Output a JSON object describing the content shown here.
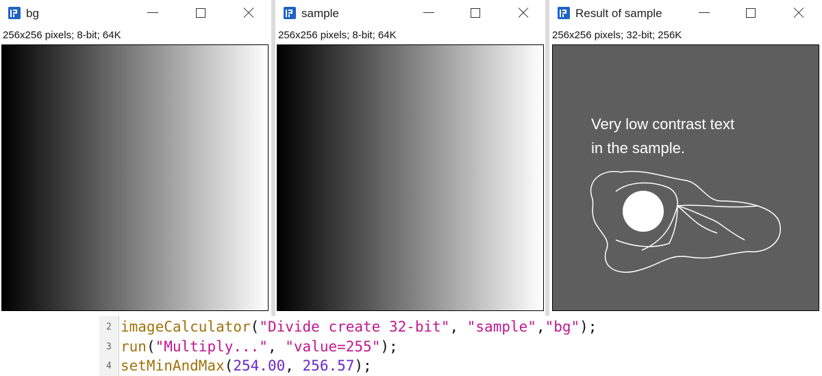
{
  "windows": [
    {
      "title": "bg",
      "info": "256x256 pixels; 8-bit; 64K"
    },
    {
      "title": "sample",
      "info": "256x256 pixels; 8-bit; 64K"
    },
    {
      "title": "Result of sample",
      "info": "256x256 pixels; 32-bit; 256K"
    }
  ],
  "result_image": {
    "text_line1": "Very low contrast text",
    "text_line2": "in the sample.",
    "background_color": "#5e5e5e",
    "drawing_color": "#ffffff"
  },
  "colors": {
    "gradient_start": "#000000",
    "gradient_end": "#ffffff",
    "app_icon": "#1e63c8"
  },
  "code": {
    "lines": [
      {
        "number": "2",
        "tokens": [
          {
            "t": "imageCalculator",
            "k": "fn"
          },
          {
            "t": "(",
            "k": "pun"
          },
          {
            "t": "\"Divide create 32-bit\"",
            "k": "str"
          },
          {
            "t": ", ",
            "k": "pun"
          },
          {
            "t": "\"sample\"",
            "k": "str"
          },
          {
            "t": ",",
            "k": "pun"
          },
          {
            "t": "\"bg\"",
            "k": "str"
          },
          {
            "t": ");",
            "k": "pun"
          }
        ]
      },
      {
        "number": "3",
        "tokens": [
          {
            "t": "run",
            "k": "fn"
          },
          {
            "t": "(",
            "k": "pun"
          },
          {
            "t": "\"Multiply...\"",
            "k": "str"
          },
          {
            "t": ", ",
            "k": "pun"
          },
          {
            "t": "\"value=255\"",
            "k": "str"
          },
          {
            "t": ");",
            "k": "pun"
          }
        ]
      },
      {
        "number": "4",
        "tokens": [
          {
            "t": "setMinAndMax",
            "k": "fn"
          },
          {
            "t": "(",
            "k": "pun"
          },
          {
            "t": "254.00",
            "k": "num"
          },
          {
            "t": ", ",
            "k": "pun"
          },
          {
            "t": "256.57",
            "k": "num"
          },
          {
            "t": ");",
            "k": "pun"
          }
        ]
      }
    ]
  }
}
